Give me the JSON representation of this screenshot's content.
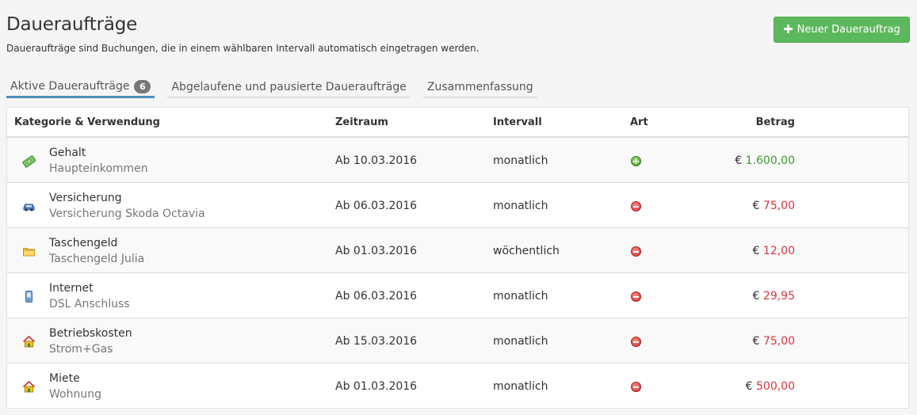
{
  "header": {
    "title": "Daueraufträge",
    "subtitle": "Daueraufträge sind Buchungen, die in einem wählbaren Intervall automatisch eingetragen werden.",
    "new_button_label": "Neuer Dauerauftrag",
    "new_button_icon": "plus-icon"
  },
  "tabs": [
    {
      "label": "Aktive Daueraufträge",
      "badge": "6",
      "active": true
    },
    {
      "label": "Abgelaufene und pausierte Daueraufträge"
    },
    {
      "label": "Zusammenfassung"
    }
  ],
  "table": {
    "columns": [
      "Kategorie & Verwendung",
      "Zeitraum",
      "Intervall",
      "Art",
      "Betrag"
    ],
    "rows": [
      {
        "icon": "money-icon",
        "category": "Gehalt",
        "purpose": "Haupteinkommen",
        "period": "Ab 10.03.2016",
        "interval": "monatlich",
        "type": "income",
        "currency": "€",
        "amount": "1.600,00"
      },
      {
        "icon": "car-icon",
        "category": "Versicherung",
        "purpose": "Versicherung Skoda Octavia",
        "period": "Ab 06.03.2016",
        "interval": "monatlich",
        "type": "expense",
        "currency": "€",
        "amount": "75,00"
      },
      {
        "icon": "folder-icon",
        "category": "Taschengeld",
        "purpose": "Taschengeld Julia",
        "period": "Ab 01.03.2016",
        "interval": "wöchentlich",
        "type": "expense",
        "currency": "€",
        "amount": "12,00"
      },
      {
        "icon": "phone-icon",
        "category": "Internet",
        "purpose": "DSL Anschluss",
        "period": "Ab 06.03.2016",
        "interval": "monatlich",
        "type": "expense",
        "currency": "€",
        "amount": "29,95"
      },
      {
        "icon": "house-icon",
        "category": "Betriebskosten",
        "purpose": "Strom+Gas",
        "period": "Ab 15.03.2016",
        "interval": "monatlich",
        "type": "expense",
        "currency": "€",
        "amount": "75,00"
      },
      {
        "icon": "house-icon",
        "category": "Miete",
        "purpose": "Wohnung",
        "period": "Ab 01.03.2016",
        "interval": "monatlich",
        "type": "expense",
        "currency": "€",
        "amount": "500,00"
      }
    ]
  },
  "colors": {
    "accent_green": "#5cb85c",
    "income": "#3c9a2f",
    "expense": "#d9363e",
    "tab_active": "#4a90b8"
  }
}
